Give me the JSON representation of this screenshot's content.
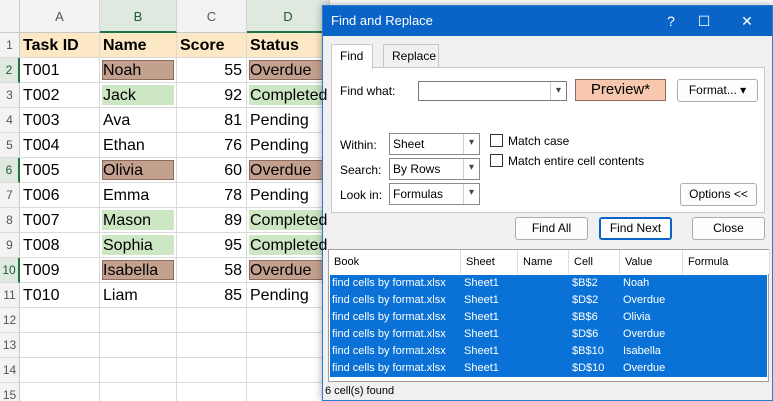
{
  "sheet": {
    "columns": [
      "A",
      "B",
      "C",
      "D"
    ],
    "rows": [
      "1",
      "2",
      "3",
      "4",
      "5",
      "6",
      "7",
      "8",
      "9",
      "10",
      "11",
      "12",
      "13",
      "14",
      "15"
    ],
    "headers": {
      "task_id": "Task ID",
      "name": "Name",
      "score": "Score",
      "status": "Status"
    },
    "data": [
      {
        "id": "T001",
        "name": "Noah",
        "score": "55",
        "status": "Overdue",
        "fill": "brown"
      },
      {
        "id": "T002",
        "name": "Jack",
        "score": "92",
        "status": "Completed",
        "fill": "green"
      },
      {
        "id": "T003",
        "name": "Ava",
        "score": "81",
        "status": "Pending",
        "fill": "none"
      },
      {
        "id": "T004",
        "name": "Ethan",
        "score": "76",
        "status": "Pending",
        "fill": "none"
      },
      {
        "id": "T005",
        "name": "Olivia",
        "score": "60",
        "status": "Overdue",
        "fill": "brown"
      },
      {
        "id": "T006",
        "name": "Emma",
        "score": "78",
        "status": "Pending",
        "fill": "none"
      },
      {
        "id": "T007",
        "name": "Mason",
        "score": "89",
        "status": "Completed",
        "fill": "green"
      },
      {
        "id": "T008",
        "name": "Sophia",
        "score": "95",
        "status": "Completed",
        "fill": "green"
      },
      {
        "id": "T009",
        "name": "Isabella",
        "score": "58",
        "status": "Overdue",
        "fill": "brown"
      },
      {
        "id": "T010",
        "name": "Liam",
        "score": "85",
        "status": "Pending",
        "fill": "none"
      }
    ],
    "colors": {
      "brown": "#c4a08f",
      "green": "#cde6c4",
      "header": "#fde8c6"
    }
  },
  "dialog": {
    "title": "Find and Replace",
    "tabs": [
      {
        "label": "Find",
        "active": true
      },
      {
        "label": "Replace",
        "active": false
      }
    ],
    "find_what_label": "Find what:",
    "find_what_value": "",
    "preview_label": "Preview*",
    "format_button": "Format...",
    "within_label": "Within:",
    "within_value": "Sheet",
    "search_label": "Search:",
    "search_value": "By Rows",
    "lookin_label": "Look in:",
    "lookin_value": "Formulas",
    "match_case_label": "Match case",
    "match_entire_label": "Match entire cell contents",
    "options_button": "Options <<",
    "find_all_button": "Find All",
    "find_next_button": "Find Next",
    "close_button": "Close",
    "results_headers": [
      "Book",
      "Sheet",
      "Name",
      "Cell",
      "Value",
      "Formula"
    ],
    "results": [
      {
        "book": "find cells by format.xlsx",
        "sheet": "Sheet1",
        "name": "",
        "cell": "$B$2",
        "value": "Noah",
        "formula": ""
      },
      {
        "book": "find cells by format.xlsx",
        "sheet": "Sheet1",
        "name": "",
        "cell": "$D$2",
        "value": "Overdue",
        "formula": ""
      },
      {
        "book": "find cells by format.xlsx",
        "sheet": "Sheet1",
        "name": "",
        "cell": "$B$6",
        "value": "Olivia",
        "formula": ""
      },
      {
        "book": "find cells by format.xlsx",
        "sheet": "Sheet1",
        "name": "",
        "cell": "$D$6",
        "value": "Overdue",
        "formula": ""
      },
      {
        "book": "find cells by format.xlsx",
        "sheet": "Sheet1",
        "name": "",
        "cell": "$B$10",
        "value": "Isabella",
        "formula": ""
      },
      {
        "book": "find cells by format.xlsx",
        "sheet": "Sheet1",
        "name": "",
        "cell": "$D$10",
        "value": "Overdue",
        "formula": ""
      }
    ],
    "status_text": "6 cell(s) found",
    "accent_color": "#0a64c8"
  }
}
